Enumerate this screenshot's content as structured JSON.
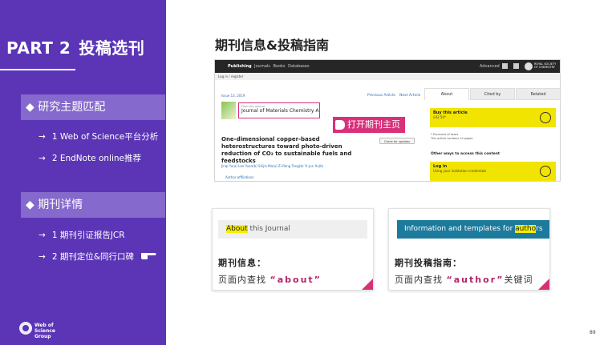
{
  "left_panel": {
    "part_label": "PART 2",
    "part_title": "投稿选刊",
    "section1": {
      "label": "◆ 研究主题匹配"
    },
    "section1_items": [
      "1 Web of Science平台分析",
      "2 EndNote online推荐"
    ],
    "section2": {
      "label": "◆ 期刊详情"
    },
    "section2_items": [
      "1 期刊引证报告JCR",
      "2 期刊定位&同行口碑"
    ],
    "logo_lines": [
      "Web of",
      "Science",
      "Group"
    ],
    "colors": {
      "background": "#5b35b6",
      "section_bg": "#8569cc"
    }
  },
  "main": {
    "title": "期刊信息&投稿指南",
    "page_number": "89"
  },
  "screenshot": {
    "topbar": {
      "brand": "Publishing",
      "nav": "Journals   Books   Databases",
      "advanced": "Advanced",
      "org": "ROYAL SOCIETY OF CHEMISTRY"
    },
    "subbar": "Log in / register",
    "issue": "Issue 13, 2019",
    "prev_article": "Previous Article",
    "next_article": "Next Article",
    "from_journal": "From the journal",
    "journal_name": "Journal of Materials Chemistry A",
    "callout": "打开期刊主页",
    "article_title": "One-dimensional copper-based heterostructures toward photo-driven reduction of CO₂ to sustainable fuels and feedstocks",
    "check_updates": "Check for updates",
    "authors": "Jinqi Yu(a)  Lan Yuan(b)  Shijie Ma(a)  Zi-Rong Tang(b)  Yi-Jun Xu(b)",
    "affiliations": "Author affiliations",
    "tabs": [
      "About",
      "Cited by",
      "Related"
    ],
    "buy_title": "Buy this article",
    "buy_price": "£42.50*",
    "excl_vat": "* Exclusive of taxes",
    "excl_pages": "This article contains 14 pages",
    "other_ways": "Other ways to access this content",
    "login_title": "Log in",
    "login_sub": "Using your institution credentials"
  },
  "card_about": {
    "strip_hl": "About",
    "strip_rest": " this Journal",
    "heading": "期刊信息：",
    "body_prefix": "页面内查找 ",
    "keyword": "“about”",
    "body_suffix": ""
  },
  "card_info": {
    "strip_prefix": "Information and templates for ",
    "strip_hl": "autho",
    "strip_suffix": "rs",
    "heading": "期刊投稿指南：",
    "body_prefix": "页面内查找 ",
    "keyword": "“author”",
    "body_suffix": "关键词"
  },
  "accent_color": "#d8307a"
}
